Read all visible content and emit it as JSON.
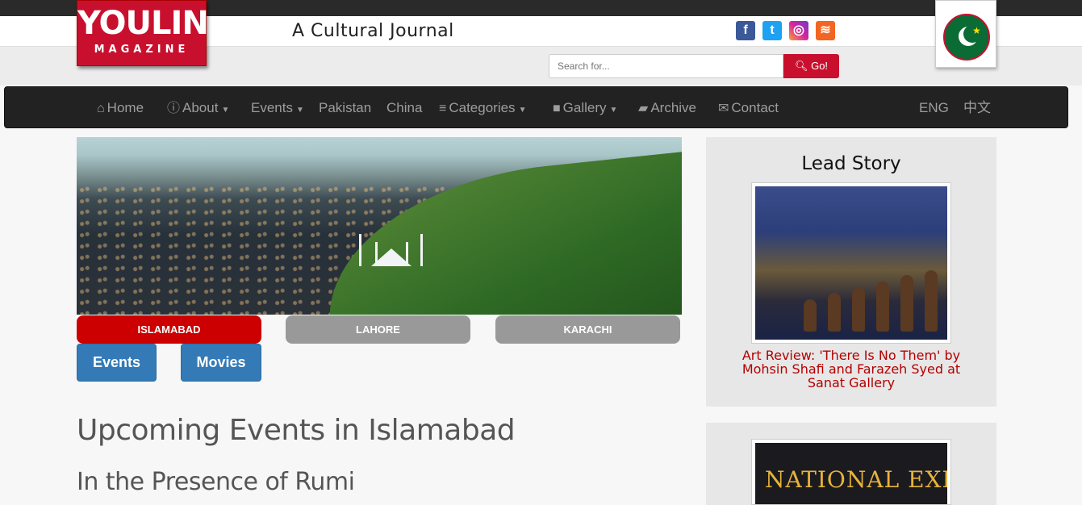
{
  "header": {
    "logo_main": "YOULIN",
    "logo_sub": "MAGAZINE",
    "tagline": "A Cultural Journal",
    "social": {
      "facebook": "f",
      "twitter": "t",
      "instagram": "◎",
      "rss": "≋"
    }
  },
  "search": {
    "placeholder": "Search for...",
    "button_label": "Go!",
    "button_icon": "search-icon"
  },
  "nav": {
    "home": "Home",
    "about": "About",
    "events": "Events",
    "pakistan": "Pakistan",
    "china": "China",
    "categories": "Categories",
    "gallery": "Gallery",
    "archive": "Archive",
    "contact": "Contact",
    "lang_eng": "ENG",
    "lang_cn": "中文"
  },
  "city_tabs": {
    "islamabad": "ISLAMABAD",
    "lahore": "LAHORE",
    "karachi": "KARACHI"
  },
  "buttons": {
    "events": "Events",
    "movies": "Movies"
  },
  "main": {
    "page_title": "Upcoming Events in Islamabad",
    "event_title": "In the Presence of Rumi"
  },
  "sidebar": {
    "lead_heading": "Lead Story",
    "lead_caption": "Art Review: 'There Is No Them' by Mohsin Shafi and Farazeh Syed at Sanat Gallery",
    "box2_image_text": "NATIONAL EXHIBITION"
  },
  "colors": {
    "brand_red": "#c8102e",
    "nav_bg": "#222222",
    "button_blue": "#337ab7",
    "tab_active": "#cc0000",
    "tab_inactive": "#999999"
  }
}
